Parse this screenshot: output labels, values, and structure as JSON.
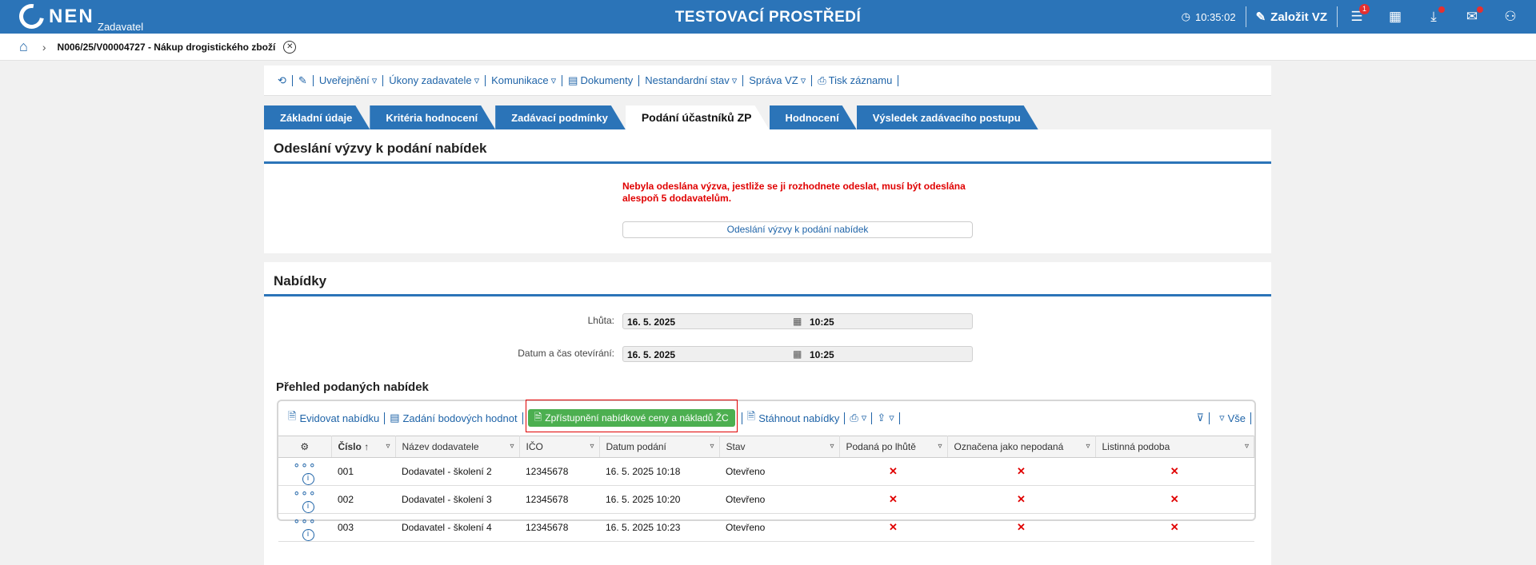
{
  "topbar": {
    "logo": "NEN",
    "logo_sub": "Zadavatel",
    "env_title": "TESTOVACÍ PROSTŘEDÍ",
    "time": "10:35:02",
    "new_label": "Založit VZ",
    "menu_badge": "1",
    "icons": [
      "clock-icon",
      "edit-icon",
      "menu-icon",
      "calendar-icon",
      "download-icon",
      "mail-icon",
      "user-icon"
    ]
  },
  "breadcrumb": {
    "title": "N006/25/V00004727 - Nákup drogistického zboží"
  },
  "toolbar": {
    "items": [
      "Uveřejnění",
      "Úkony zadavatele",
      "Komunikace",
      "Dokumenty",
      "Nestandardní stav",
      "Správa VZ",
      "Tisk záznamu"
    ]
  },
  "tabs": [
    {
      "label": "Základní údaje",
      "active": false
    },
    {
      "label": "Kritéria hodnocení",
      "active": false
    },
    {
      "label": "Zadávací podmínky",
      "active": false
    },
    {
      "label": "Podání účastníků ZP",
      "active": true
    },
    {
      "label": "Hodnocení",
      "active": false
    },
    {
      "label": "Výsledek zadávacího postupu",
      "active": false
    }
  ],
  "invite_panel": {
    "title": "Odeslání výzvy k podání nabídek",
    "warning": "Nebyla odeslána výzva, jestliže se ji rozhodnete odeslat, musí být odeslána alespoň 5 dodavatelům.",
    "button": "Odeslání výzvy k podání nabídek"
  },
  "offers_panel": {
    "title": "Nabídky",
    "deadline_label": "Lhůta:",
    "deadline_date": "16. 5. 2025",
    "deadline_time": "10:25",
    "opening_label": "Datum a čas otevírání:",
    "opening_date": "16. 5. 2025",
    "opening_time": "10:25",
    "overview_title": "Přehled podaných nabídek",
    "grid_toolbar": {
      "register": "Evidovat nabídku",
      "points": "Zadání bodových hodnot",
      "publish": "Zpřístupnění nabídkové ceny a nákladů ŽC",
      "download": "Stáhnout nabídky",
      "all": "Vše"
    },
    "columns": [
      "Číslo",
      "Název dodavatele",
      "IČO",
      "Datum podání",
      "Stav",
      "Podaná po lhůtě",
      "Označena jako nepodaná",
      "Listinná podoba"
    ],
    "rows": [
      {
        "number": "001",
        "supplier": "Dodavatel - školení 2",
        "ico": "12345678",
        "submitted": "16. 5. 2025 10:18",
        "state": "Otevřeno",
        "late": "✕",
        "not_submitted": "✕",
        "paper": "✕"
      },
      {
        "number": "002",
        "supplier": "Dodavatel - školení 3",
        "ico": "12345678",
        "submitted": "16. 5. 2025 10:20",
        "state": "Otevřeno",
        "late": "✕",
        "not_submitted": "✕",
        "paper": "✕"
      },
      {
        "number": "003",
        "supplier": "Dodavatel - školení 4",
        "ico": "12345678",
        "submitted": "16. 5. 2025 10:23",
        "state": "Otevřeno",
        "late": "✕",
        "not_submitted": "✕",
        "paper": "✕"
      }
    ]
  },
  "colors": {
    "primary": "#2b74b8",
    "link": "#1f64a8",
    "warning": "#e00000",
    "green": "#4caf50"
  }
}
